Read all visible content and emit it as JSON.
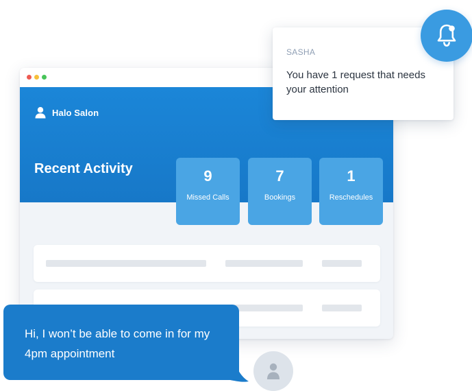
{
  "app": {
    "name": "Halo Salon",
    "section_title": "Recent Activity"
  },
  "stats": [
    {
      "value": "9",
      "label": "Missed Calls"
    },
    {
      "value": "7",
      "label": "Bookings"
    },
    {
      "value": "1",
      "label": "Reschedules"
    }
  ],
  "notification": {
    "sender": "SASHA",
    "message": "You have 1 request that needs your attention"
  },
  "chat": {
    "message": "Hi, I won’t be able to come in for my 4pm appointment"
  },
  "icons": {
    "brand": "user-icon",
    "notification": "bell-icon",
    "sender_avatar": "user-avatar-icon"
  },
  "colors": {
    "banner": "#1b86d8",
    "stat_card": "#4aa5e4",
    "chat_bubble": "#1b7ccb",
    "bell_button": "#3a9be1",
    "window_close": "#ee5a52",
    "window_minimize": "#f6bf3a",
    "window_maximize": "#48c45a"
  }
}
